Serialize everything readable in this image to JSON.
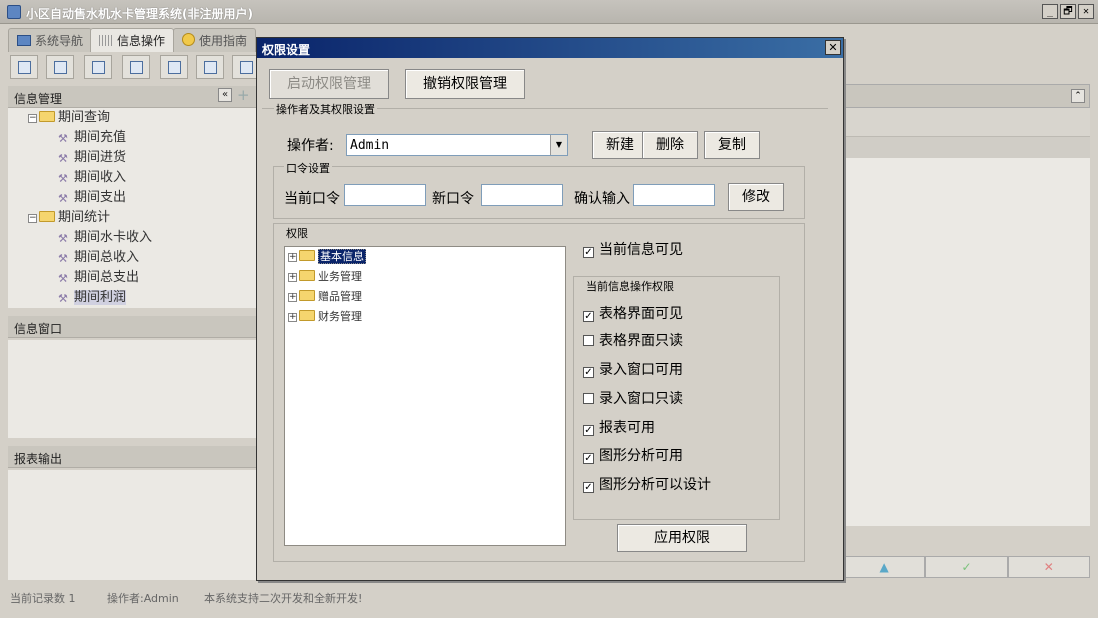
{
  "app": {
    "title": "小区自动售水机水卡管理系统(非注册用户)",
    "window_controls": {
      "minimize": "_",
      "restore": "🗗",
      "close": "✕"
    }
  },
  "main_tabs": [
    {
      "label": "系统导航",
      "active": false
    },
    {
      "label": "信息操作",
      "active": true
    },
    {
      "label": "使用指南",
      "active": false
    }
  ],
  "left": {
    "info_panel_title": "信息管理",
    "tree": [
      {
        "label": "期间查询",
        "type": "folder",
        "expand": "−"
      },
      {
        "label": "期间充值",
        "type": "leaf"
      },
      {
        "label": "期间进货",
        "type": "leaf"
      },
      {
        "label": "期间收入",
        "type": "leaf"
      },
      {
        "label": "期间支出",
        "type": "leaf"
      },
      {
        "label": "期间统计",
        "type": "folder",
        "expand": "−"
      },
      {
        "label": "期间水卡收入",
        "type": "leaf"
      },
      {
        "label": "期间总收入",
        "type": "leaf"
      },
      {
        "label": "期间总支出",
        "type": "leaf"
      },
      {
        "label": "期间利润",
        "type": "leaf",
        "selected": true
      }
    ],
    "window_panel_title": "信息窗口",
    "report_panel_title": "报表输出",
    "collapse_glyph": "«",
    "add_glyph": "+"
  },
  "right": {
    "collapse_glyph": "⌃",
    "nav": [
      "▲",
      "✓",
      "✕"
    ]
  },
  "status": {
    "records": "当前记录数 1",
    "operator": "操作者:Admin",
    "message": "本系统支持二次开发和全新开发!"
  },
  "dialog": {
    "title": "权限设置",
    "close": "✕",
    "enable_button": "启动权限管理",
    "revoke_button": "撤销权限管理",
    "operator_group": "操作者及其权限设置",
    "operator_label": "操作者:",
    "operator_value": "Admin",
    "combo_arrow": "▼",
    "new_button": "新建",
    "delete_button": "删除",
    "copy_button": "复制",
    "password_group": "口令设置",
    "current_pw_label": "当前口令",
    "new_pw_label": "新口令",
    "confirm_pw_label": "确认输入",
    "modify_button": "修改",
    "permission_group": "权限",
    "perm_tree": [
      {
        "label": "基本信息",
        "selected": true
      },
      {
        "label": "业务管理",
        "selected": false
      },
      {
        "label": "赠品管理",
        "selected": false
      },
      {
        "label": "财务管理",
        "selected": false
      }
    ],
    "expand_glyph": "+",
    "check_glyph": "✓",
    "current_visible": {
      "label": "当前信息可见",
      "checked": true
    },
    "ops_group": "当前信息操作权限",
    "ops": [
      {
        "label": "表格界面可见",
        "checked": true
      },
      {
        "label": "表格界面只读",
        "checked": false
      },
      {
        "label": "录入窗口可用",
        "checked": true
      },
      {
        "label": "录入窗口只读",
        "checked": false
      },
      {
        "label": "报表可用",
        "checked": true
      },
      {
        "label": "图形分析可用",
        "checked": true
      },
      {
        "label": "图形分析可以设计",
        "checked": true
      }
    ],
    "apply_button": "应用权限"
  }
}
